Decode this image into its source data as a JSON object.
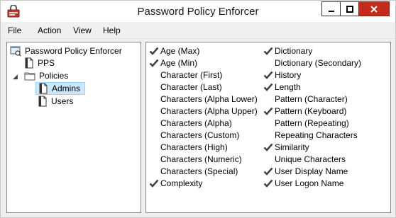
{
  "window": {
    "title": "Password Policy Enforcer",
    "accent": "#c42b1c"
  },
  "menu": [
    "File",
    "Action",
    "View",
    "Help"
  ],
  "tree": {
    "root": "Password Policy Enforcer",
    "pps": "PPS",
    "policies": "Policies",
    "admins": "Admins",
    "users": "Users"
  },
  "rules_left": [
    {
      "label": "Age (Max)",
      "checked": true
    },
    {
      "label": "Age (Min)",
      "checked": true
    },
    {
      "label": "Character (First)",
      "checked": false
    },
    {
      "label": "Character (Last)",
      "checked": false
    },
    {
      "label": "Characters (Alpha Lower)",
      "checked": false
    },
    {
      "label": "Characters (Alpha Upper)",
      "checked": false
    },
    {
      "label": "Characters (Alpha)",
      "checked": false
    },
    {
      "label": "Characters (Custom)",
      "checked": false
    },
    {
      "label": "Characters (High)",
      "checked": false
    },
    {
      "label": "Characters (Numeric)",
      "checked": false
    },
    {
      "label": "Characters (Special)",
      "checked": false
    },
    {
      "label": "Complexity",
      "checked": true
    }
  ],
  "rules_right": [
    {
      "label": "Dictionary",
      "checked": true
    },
    {
      "label": "Dictionary (Secondary)",
      "checked": false
    },
    {
      "label": "History",
      "checked": true
    },
    {
      "label": "Length",
      "checked": true
    },
    {
      "label": "Pattern (Character)",
      "checked": false
    },
    {
      "label": "Pattern (Keyboard)",
      "checked": true
    },
    {
      "label": "Pattern (Repeating)",
      "checked": false
    },
    {
      "label": "Repeating Characters",
      "checked": false
    },
    {
      "label": "Similarity",
      "checked": true
    },
    {
      "label": "Unique Characters",
      "checked": false
    },
    {
      "label": "User Display Name",
      "checked": true
    },
    {
      "label": "User Logon Name",
      "checked": true
    }
  ]
}
